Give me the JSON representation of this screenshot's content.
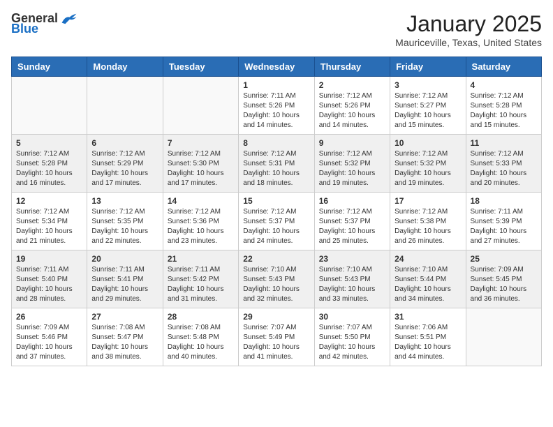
{
  "header": {
    "logo_general": "General",
    "logo_blue": "Blue",
    "month_year": "January 2025",
    "location": "Mauriceville, Texas, United States"
  },
  "days_of_week": [
    "Sunday",
    "Monday",
    "Tuesday",
    "Wednesday",
    "Thursday",
    "Friday",
    "Saturday"
  ],
  "weeks": [
    [
      {
        "day": "",
        "sunrise": "",
        "sunset": "",
        "daylight": ""
      },
      {
        "day": "",
        "sunrise": "",
        "sunset": "",
        "daylight": ""
      },
      {
        "day": "",
        "sunrise": "",
        "sunset": "",
        "daylight": ""
      },
      {
        "day": "1",
        "sunrise": "Sunrise: 7:11 AM",
        "sunset": "Sunset: 5:26 PM",
        "daylight": "Daylight: 10 hours and 14 minutes."
      },
      {
        "day": "2",
        "sunrise": "Sunrise: 7:12 AM",
        "sunset": "Sunset: 5:26 PM",
        "daylight": "Daylight: 10 hours and 14 minutes."
      },
      {
        "day": "3",
        "sunrise": "Sunrise: 7:12 AM",
        "sunset": "Sunset: 5:27 PM",
        "daylight": "Daylight: 10 hours and 15 minutes."
      },
      {
        "day": "4",
        "sunrise": "Sunrise: 7:12 AM",
        "sunset": "Sunset: 5:28 PM",
        "daylight": "Daylight: 10 hours and 15 minutes."
      }
    ],
    [
      {
        "day": "5",
        "sunrise": "Sunrise: 7:12 AM",
        "sunset": "Sunset: 5:28 PM",
        "daylight": "Daylight: 10 hours and 16 minutes."
      },
      {
        "day": "6",
        "sunrise": "Sunrise: 7:12 AM",
        "sunset": "Sunset: 5:29 PM",
        "daylight": "Daylight: 10 hours and 17 minutes."
      },
      {
        "day": "7",
        "sunrise": "Sunrise: 7:12 AM",
        "sunset": "Sunset: 5:30 PM",
        "daylight": "Daylight: 10 hours and 17 minutes."
      },
      {
        "day": "8",
        "sunrise": "Sunrise: 7:12 AM",
        "sunset": "Sunset: 5:31 PM",
        "daylight": "Daylight: 10 hours and 18 minutes."
      },
      {
        "day": "9",
        "sunrise": "Sunrise: 7:12 AM",
        "sunset": "Sunset: 5:32 PM",
        "daylight": "Daylight: 10 hours and 19 minutes."
      },
      {
        "day": "10",
        "sunrise": "Sunrise: 7:12 AM",
        "sunset": "Sunset: 5:32 PM",
        "daylight": "Daylight: 10 hours and 19 minutes."
      },
      {
        "day": "11",
        "sunrise": "Sunrise: 7:12 AM",
        "sunset": "Sunset: 5:33 PM",
        "daylight": "Daylight: 10 hours and 20 minutes."
      }
    ],
    [
      {
        "day": "12",
        "sunrise": "Sunrise: 7:12 AM",
        "sunset": "Sunset: 5:34 PM",
        "daylight": "Daylight: 10 hours and 21 minutes."
      },
      {
        "day": "13",
        "sunrise": "Sunrise: 7:12 AM",
        "sunset": "Sunset: 5:35 PM",
        "daylight": "Daylight: 10 hours and 22 minutes."
      },
      {
        "day": "14",
        "sunrise": "Sunrise: 7:12 AM",
        "sunset": "Sunset: 5:36 PM",
        "daylight": "Daylight: 10 hours and 23 minutes."
      },
      {
        "day": "15",
        "sunrise": "Sunrise: 7:12 AM",
        "sunset": "Sunset: 5:37 PM",
        "daylight": "Daylight: 10 hours and 24 minutes."
      },
      {
        "day": "16",
        "sunrise": "Sunrise: 7:12 AM",
        "sunset": "Sunset: 5:37 PM",
        "daylight": "Daylight: 10 hours and 25 minutes."
      },
      {
        "day": "17",
        "sunrise": "Sunrise: 7:12 AM",
        "sunset": "Sunset: 5:38 PM",
        "daylight": "Daylight: 10 hours and 26 minutes."
      },
      {
        "day": "18",
        "sunrise": "Sunrise: 7:11 AM",
        "sunset": "Sunset: 5:39 PM",
        "daylight": "Daylight: 10 hours and 27 minutes."
      }
    ],
    [
      {
        "day": "19",
        "sunrise": "Sunrise: 7:11 AM",
        "sunset": "Sunset: 5:40 PM",
        "daylight": "Daylight: 10 hours and 28 minutes."
      },
      {
        "day": "20",
        "sunrise": "Sunrise: 7:11 AM",
        "sunset": "Sunset: 5:41 PM",
        "daylight": "Daylight: 10 hours and 29 minutes."
      },
      {
        "day": "21",
        "sunrise": "Sunrise: 7:11 AM",
        "sunset": "Sunset: 5:42 PM",
        "daylight": "Daylight: 10 hours and 31 minutes."
      },
      {
        "day": "22",
        "sunrise": "Sunrise: 7:10 AM",
        "sunset": "Sunset: 5:43 PM",
        "daylight": "Daylight: 10 hours and 32 minutes."
      },
      {
        "day": "23",
        "sunrise": "Sunrise: 7:10 AM",
        "sunset": "Sunset: 5:43 PM",
        "daylight": "Daylight: 10 hours and 33 minutes."
      },
      {
        "day": "24",
        "sunrise": "Sunrise: 7:10 AM",
        "sunset": "Sunset: 5:44 PM",
        "daylight": "Daylight: 10 hours and 34 minutes."
      },
      {
        "day": "25",
        "sunrise": "Sunrise: 7:09 AM",
        "sunset": "Sunset: 5:45 PM",
        "daylight": "Daylight: 10 hours and 36 minutes."
      }
    ],
    [
      {
        "day": "26",
        "sunrise": "Sunrise: 7:09 AM",
        "sunset": "Sunset: 5:46 PM",
        "daylight": "Daylight: 10 hours and 37 minutes."
      },
      {
        "day": "27",
        "sunrise": "Sunrise: 7:08 AM",
        "sunset": "Sunset: 5:47 PM",
        "daylight": "Daylight: 10 hours and 38 minutes."
      },
      {
        "day": "28",
        "sunrise": "Sunrise: 7:08 AM",
        "sunset": "Sunset: 5:48 PM",
        "daylight": "Daylight: 10 hours and 40 minutes."
      },
      {
        "day": "29",
        "sunrise": "Sunrise: 7:07 AM",
        "sunset": "Sunset: 5:49 PM",
        "daylight": "Daylight: 10 hours and 41 minutes."
      },
      {
        "day": "30",
        "sunrise": "Sunrise: 7:07 AM",
        "sunset": "Sunset: 5:50 PM",
        "daylight": "Daylight: 10 hours and 42 minutes."
      },
      {
        "day": "31",
        "sunrise": "Sunrise: 7:06 AM",
        "sunset": "Sunset: 5:51 PM",
        "daylight": "Daylight: 10 hours and 44 minutes."
      },
      {
        "day": "",
        "sunrise": "",
        "sunset": "",
        "daylight": ""
      }
    ]
  ]
}
